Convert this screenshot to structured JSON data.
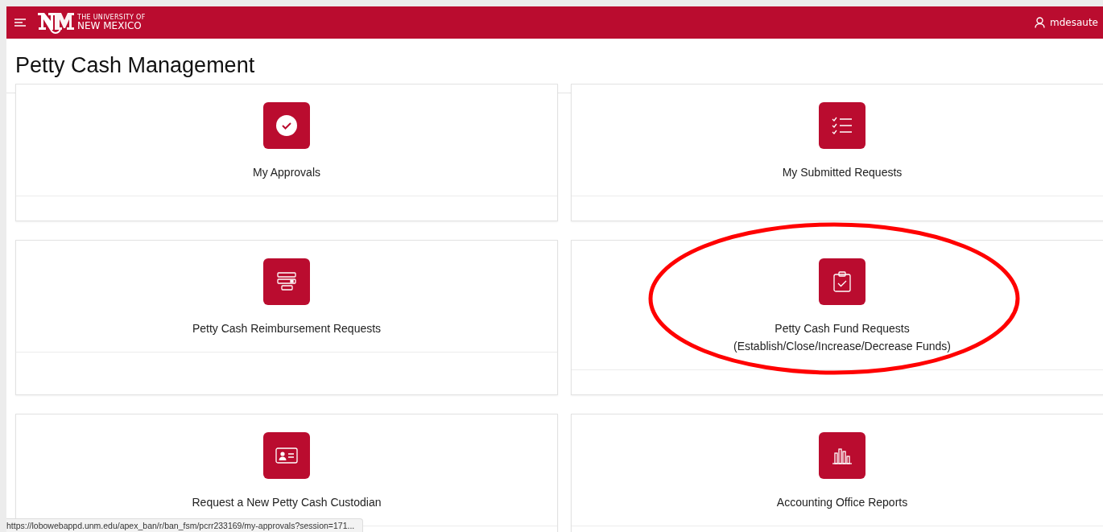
{
  "header": {
    "logo_line1": "THE UNIVERSITY OF",
    "logo_line2": "NEW MEXICO",
    "user": "mdesaute"
  },
  "page_title": "Petty Cash Management",
  "cards": [
    {
      "kind": "approvals",
      "title": "My Approvals",
      "highlighted": false
    },
    {
      "kind": "submitted",
      "title": "My Submitted Requests",
      "highlighted": false
    },
    {
      "kind": "reimbursement",
      "title": "Petty Cash Reimbursement Requests",
      "highlighted": false
    },
    {
      "kind": "fund",
      "title": "Petty Cash Fund Requests",
      "subtitle": "(Establish/Close/Increase/Decrease Funds)",
      "highlighted": true
    },
    {
      "kind": "custodian",
      "title": "Request a New Petty Cash Custodian",
      "highlighted": false
    },
    {
      "kind": "reports",
      "title": "Accounting Office Reports",
      "highlighted": false
    }
  ],
  "status_url": "https://lobowebappd.unm.edu/apex_ban/r/ban_fsm/pcrr233169/my-approvals?session=171..."
}
